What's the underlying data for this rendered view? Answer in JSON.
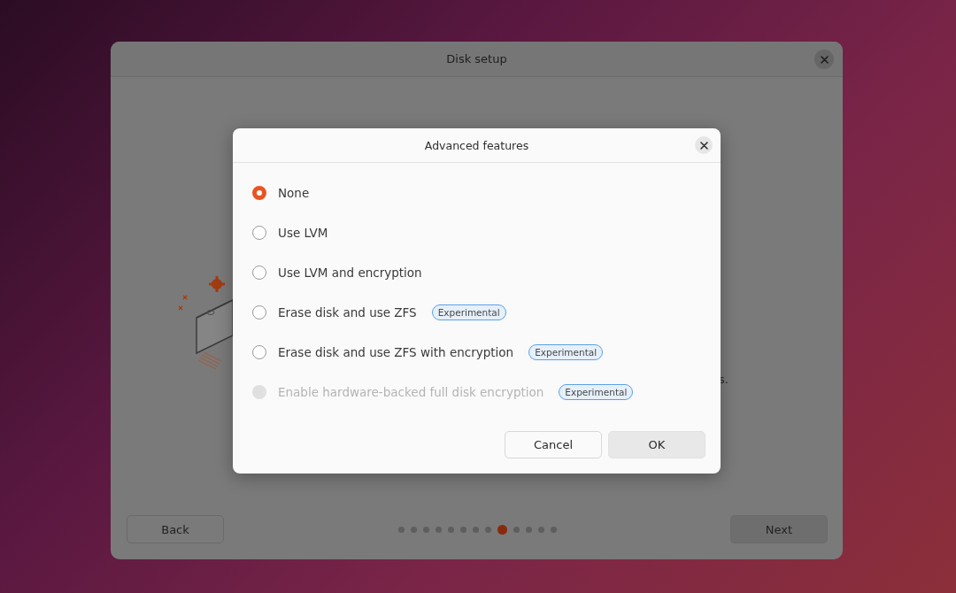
{
  "window": {
    "title": "Disk setup",
    "body_text": "s."
  },
  "footer": {
    "back": "Back",
    "next": "Next",
    "steps": [
      {
        "selected": false
      },
      {
        "selected": false
      },
      {
        "selected": false
      },
      {
        "selected": false
      },
      {
        "selected": false
      },
      {
        "selected": false
      },
      {
        "selected": false
      },
      {
        "selected": false
      },
      {
        "selected": true
      },
      {
        "selected": false
      },
      {
        "selected": false
      },
      {
        "selected": false
      },
      {
        "selected": false
      }
    ]
  },
  "dialog": {
    "title": "Advanced features",
    "options": [
      {
        "label": "None",
        "selected": true,
        "disabled": false
      },
      {
        "label": "Use LVM",
        "selected": false,
        "disabled": false
      },
      {
        "label": "Use LVM and encryption",
        "selected": false,
        "disabled": false
      },
      {
        "label": "Erase disk and use ZFS",
        "selected": false,
        "disabled": false,
        "badge": "Experimental"
      },
      {
        "label": "Erase disk and use ZFS with encryption",
        "selected": false,
        "disabled": false,
        "badge": "Experimental"
      },
      {
        "label": "Enable hardware-backed full disk encryption",
        "selected": false,
        "disabled": true,
        "badge": "Experimental"
      }
    ],
    "buttons": [
      {
        "label": "Cancel",
        "kind": "secondary"
      },
      {
        "label": "OK",
        "kind": "default"
      }
    ]
  }
}
